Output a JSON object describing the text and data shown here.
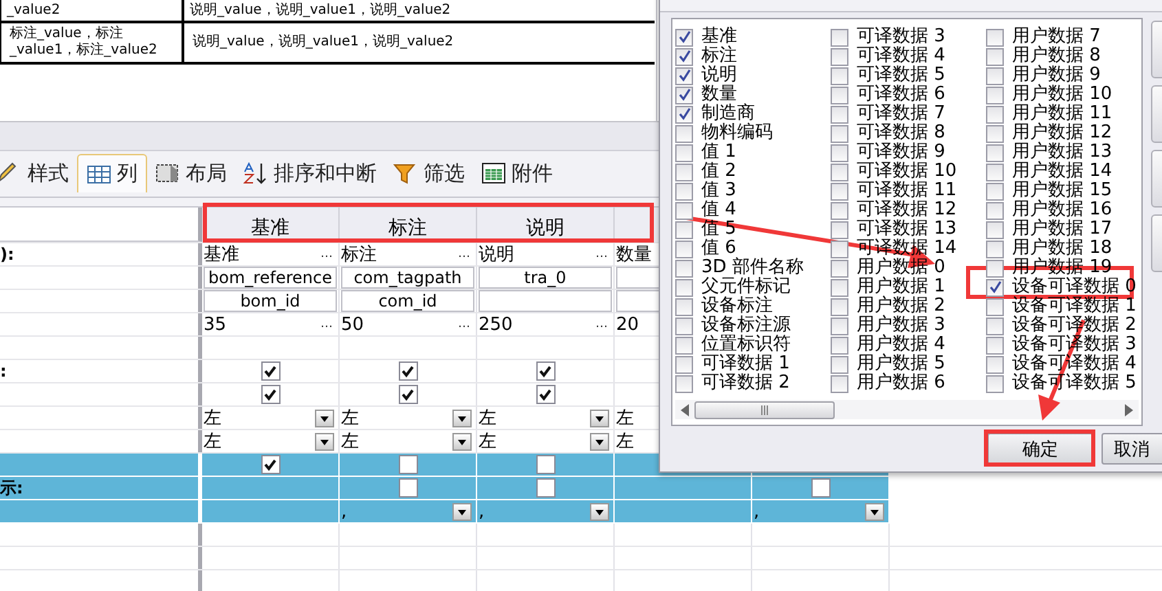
{
  "preview_table": {
    "rows": [
      {
        "column_1": "_value2",
        "column_2": "说明_value，说明_value1，说明_value2"
      },
      {
        "column_1": "标注_value，标注_value1，标注_value2",
        "column_2": "说明_value，说明_value1，说明_value2"
      }
    ]
  },
  "tabs": [
    {
      "label": "样式",
      "selected": false
    },
    {
      "label": "列",
      "selected": true
    },
    {
      "label": "布局",
      "selected": false
    },
    {
      "label": "排序和中断",
      "selected": false
    },
    {
      "label": "筛选",
      "selected": false
    },
    {
      "label": "附件",
      "selected": false
    }
  ],
  "grid": {
    "columns": [
      "基准",
      "标注",
      "说明"
    ],
    "rows": [
      {
        "label": "):",
        "highlighted": false,
        "cells": [
          {
            "kind": "text",
            "text": "基准",
            "button": "…"
          },
          {
            "kind": "text",
            "text": "标注",
            "button": "…"
          },
          {
            "kind": "text",
            "text": "说明",
            "button": "…"
          },
          {
            "kind": "text",
            "text": "数量"
          },
          {
            "kind": "empty"
          }
        ]
      },
      {
        "highlighted": false,
        "cells": [
          {
            "kind": "field",
            "text": "bom_reference"
          },
          {
            "kind": "field",
            "text": "com_tagpath"
          },
          {
            "kind": "field",
            "text": "tra_0"
          },
          {
            "kind": "field"
          },
          {
            "kind": "empty"
          }
        ]
      },
      {
        "highlighted": false,
        "cells": [
          {
            "kind": "field",
            "text": "bom_id"
          },
          {
            "kind": "field",
            "text": "com_id"
          },
          {
            "kind": "field"
          },
          {
            "kind": "field"
          },
          {
            "kind": "empty"
          }
        ]
      },
      {
        "highlighted": false,
        "cells": [
          {
            "kind": "text",
            "text": "35",
            "button": "…"
          },
          {
            "kind": "text",
            "text": "50",
            "button": "…"
          },
          {
            "kind": "text",
            "text": "250",
            "button": "…"
          },
          {
            "kind": "text",
            "text": "20"
          },
          {
            "kind": "empty"
          }
        ]
      },
      {
        "highlighted": false,
        "cells": [
          {
            "kind": "empty"
          },
          {
            "kind": "empty"
          },
          {
            "kind": "empty"
          },
          {
            "kind": "empty"
          },
          {
            "kind": "empty"
          }
        ]
      },
      {
        "label": ":",
        "highlighted": false,
        "cells": [
          {
            "kind": "check",
            "checked": true
          },
          {
            "kind": "check",
            "checked": true
          },
          {
            "kind": "check",
            "checked": true
          },
          {
            "kind": "empty"
          },
          {
            "kind": "empty"
          }
        ]
      },
      {
        "highlighted": false,
        "cells": [
          {
            "kind": "check",
            "checked": true
          },
          {
            "kind": "check",
            "checked": true
          },
          {
            "kind": "check",
            "checked": true
          },
          {
            "kind": "empty"
          },
          {
            "kind": "empty"
          }
        ]
      },
      {
        "highlighted": false,
        "cells": [
          {
            "kind": "select",
            "text": "左"
          },
          {
            "kind": "select",
            "text": "左"
          },
          {
            "kind": "select",
            "text": "左"
          },
          {
            "kind": "select",
            "text": "左"
          },
          {
            "kind": "empty"
          }
        ]
      },
      {
        "highlighted": false,
        "cells": [
          {
            "kind": "select",
            "text": "左"
          },
          {
            "kind": "select",
            "text": "左"
          },
          {
            "kind": "select",
            "text": "左"
          },
          {
            "kind": "select",
            "text": "左"
          },
          {
            "kind": "empty"
          }
        ]
      },
      {
        "highlighted": true,
        "cells": [
          {
            "kind": "check",
            "checked": true
          },
          {
            "kind": "check",
            "checked": false
          },
          {
            "kind": "check",
            "checked": false
          },
          {
            "kind": "empty"
          },
          {
            "kind": "empty"
          }
        ]
      },
      {
        "label": "示:",
        "highlighted": true,
        "cells": [
          {
            "kind": "empty"
          },
          {
            "kind": "check",
            "checked": false
          },
          {
            "kind": "check",
            "checked": false
          },
          {
            "kind": "empty"
          },
          {
            "kind": "check",
            "checked": false
          }
        ]
      },
      {
        "highlighted": true,
        "cells": [
          {
            "kind": "empty"
          },
          {
            "kind": "select",
            "text": ","
          },
          {
            "kind": "select",
            "text": ","
          },
          {
            "kind": "empty"
          },
          {
            "kind": "select",
            "text": ","
          }
        ]
      },
      {
        "highlighted": false,
        "cells": [
          {
            "kind": "empty"
          },
          {
            "kind": "empty"
          },
          {
            "kind": "empty"
          },
          {
            "kind": "empty"
          },
          {
            "kind": "empty"
          }
        ]
      },
      {
        "highlighted": false,
        "cells": [
          {
            "kind": "empty"
          },
          {
            "kind": "empty"
          },
          {
            "kind": "empty"
          },
          {
            "kind": "empty"
          },
          {
            "kind": "empty"
          }
        ]
      },
      {
        "highlighted": false,
        "cells": [
          {
            "kind": "empty"
          },
          {
            "kind": "empty"
          },
          {
            "kind": "empty"
          },
          {
            "kind": "empty"
          },
          {
            "kind": "empty"
          }
        ]
      }
    ]
  },
  "dialog": {
    "columns": [
      [
        {
          "label": "基准",
          "checked": true
        },
        {
          "label": "标注",
          "checked": true
        },
        {
          "label": "说明",
          "checked": true
        },
        {
          "label": "数量",
          "checked": true
        },
        {
          "label": "制造商",
          "checked": true
        },
        {
          "label": "物料编码",
          "checked": false
        },
        {
          "label": "值 1",
          "checked": false
        },
        {
          "label": "值 2",
          "checked": false
        },
        {
          "label": "值 3",
          "checked": false
        },
        {
          "label": "值 4",
          "checked": false
        },
        {
          "label": "值 5",
          "checked": false
        },
        {
          "label": "值 6",
          "checked": false
        },
        {
          "label": "3D 部件名称",
          "checked": false
        },
        {
          "label": "父元件标记",
          "checked": false
        },
        {
          "label": "设备标注",
          "checked": false
        },
        {
          "label": "设备标注源",
          "checked": false
        },
        {
          "label": "位置标识符",
          "checked": false
        },
        {
          "label": "可译数据 1",
          "checked": false
        },
        {
          "label": "可译数据 2",
          "checked": false
        }
      ],
      [
        {
          "label": "可译数据 3",
          "checked": false
        },
        {
          "label": "可译数据 4",
          "checked": false
        },
        {
          "label": "可译数据 5",
          "checked": false
        },
        {
          "label": "可译数据 6",
          "checked": false
        },
        {
          "label": "可译数据 7",
          "checked": false
        },
        {
          "label": "可译数据 8",
          "checked": false
        },
        {
          "label": "可译数据 9",
          "checked": false
        },
        {
          "label": "可译数据 10",
          "checked": false
        },
        {
          "label": "可译数据 11",
          "checked": false
        },
        {
          "label": "可译数据 12",
          "checked": false
        },
        {
          "label": "可译数据 13",
          "checked": false
        },
        {
          "label": "可译数据 14",
          "checked": false
        },
        {
          "label": "用户数据 0",
          "checked": false
        },
        {
          "label": "用户数据 1",
          "checked": false
        },
        {
          "label": "用户数据 2",
          "checked": false
        },
        {
          "label": "用户数据 3",
          "checked": false
        },
        {
          "label": "用户数据 4",
          "checked": false
        },
        {
          "label": "用户数据 5",
          "checked": false
        },
        {
          "label": "用户数据 6",
          "checked": false
        }
      ],
      [
        {
          "label": "用户数据 7",
          "checked": false
        },
        {
          "label": "用户数据 8",
          "checked": false
        },
        {
          "label": "用户数据 9",
          "checked": false
        },
        {
          "label": "用户数据 10",
          "checked": false
        },
        {
          "label": "用户数据 11",
          "checked": false
        },
        {
          "label": "用户数据 12",
          "checked": false
        },
        {
          "label": "用户数据 13",
          "checked": false
        },
        {
          "label": "用户数据 14",
          "checked": false
        },
        {
          "label": "用户数据 15",
          "checked": false
        },
        {
          "label": "用户数据 16",
          "checked": false
        },
        {
          "label": "用户数据 17",
          "checked": false
        },
        {
          "label": "用户数据 18",
          "checked": false
        },
        {
          "label": "用户数据 19",
          "checked": false
        },
        {
          "label": "设备可译数据 0",
          "checked": true
        },
        {
          "label": "设备可译数据 1",
          "checked": false
        },
        {
          "label": "设备可译数据 2",
          "checked": false
        },
        {
          "label": "设备可译数据 3",
          "checked": false
        },
        {
          "label": "设备可译数据 4",
          "checked": false
        },
        {
          "label": "设备可译数据 5",
          "checked": false
        }
      ]
    ],
    "buttons": [
      "确定",
      "取消"
    ]
  }
}
